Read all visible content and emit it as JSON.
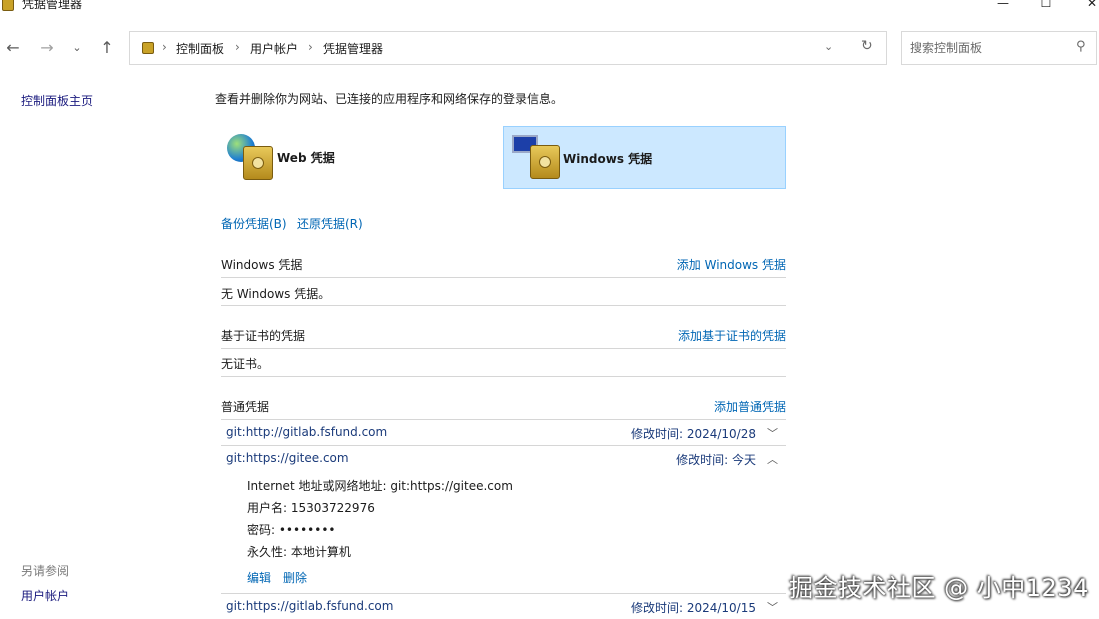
{
  "window": {
    "title": "凭据管理器"
  },
  "address": {
    "crumbs": [
      "控制面板",
      "用户帐户",
      "凭据管理器"
    ]
  },
  "search": {
    "placeholder": "搜索控制面板"
  },
  "left": {
    "home_link": "控制面板主页",
    "see_also": "另请参阅",
    "user_accounts": "用户帐户"
  },
  "main": {
    "description": "查看并删除你为网站、已连接的应用程序和网络保存的登录信息。",
    "tiles": {
      "web": "Web 凭据",
      "windows": "Windows 凭据"
    },
    "backup_link": "备份凭据(B)",
    "restore_link": "还原凭据(R)",
    "windows_section": {
      "title": "Windows 凭据",
      "action": "添加 Windows 凭据",
      "empty": "无 Windows 凭据。"
    },
    "cert_section": {
      "title": "基于证书的凭据",
      "action": "添加基于证书的凭据",
      "empty": "无证书。"
    },
    "generic_section": {
      "title": "普通凭据",
      "action": "添加普通凭据",
      "items": [
        {
          "name": "git:http://gitlab.fsfund.com",
          "modified": "修改时间:  2024/10/28"
        },
        {
          "name": "git:https://gitee.com",
          "modified": "修改时间:  今天"
        },
        {
          "name": "git:https://gitlab.fsfund.com",
          "modified": "修改时间:  2024/10/15"
        }
      ],
      "expanded": {
        "address": "Internet 地址或网络地址:  git:https://gitee.com",
        "username": "用户名:  15303722976",
        "password": "密码:  ••••••••",
        "persistence": "永久性:  本地计算机",
        "edit": "编辑",
        "delete": "删除"
      }
    }
  },
  "watermark": "掘金技术社区 @ 小中1234"
}
